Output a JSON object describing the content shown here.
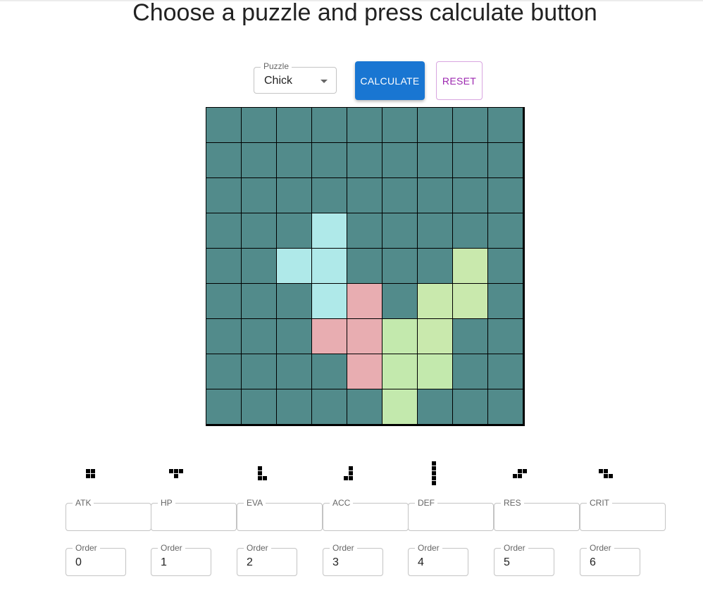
{
  "title": "Choose a puzzle and press calculate button",
  "controls": {
    "puzzle_label": "Puzzle",
    "puzzle_value": "Chick",
    "calculate_label": "CALCULATE",
    "reset_label": "RESET"
  },
  "board": {
    "rows": 9,
    "cols": 9,
    "background_color": "#528b8b",
    "cells": [
      {
        "r": 3,
        "c": 3,
        "color": "#afe9e9"
      },
      {
        "r": 4,
        "c": 2,
        "color": "#afe9e9"
      },
      {
        "r": 4,
        "c": 3,
        "color": "#afe9e9"
      },
      {
        "r": 5,
        "c": 3,
        "color": "#afe9e9"
      },
      {
        "r": 5,
        "c": 4,
        "color": "#e8adb1"
      },
      {
        "r": 6,
        "c": 3,
        "color": "#e8adb1"
      },
      {
        "r": 6,
        "c": 4,
        "color": "#e8adb1"
      },
      {
        "r": 7,
        "c": 4,
        "color": "#e8adb1"
      },
      {
        "r": 4,
        "c": 7,
        "color": "#c9e9ad"
      },
      {
        "r": 5,
        "c": 6,
        "color": "#c9e9ad"
      },
      {
        "r": 5,
        "c": 7,
        "color": "#c9e9ad"
      },
      {
        "r": 6,
        "c": 6,
        "color": "#c9e9ad"
      },
      {
        "r": 6,
        "c": 5,
        "color": "#c3e9ad"
      },
      {
        "r": 7,
        "c": 5,
        "color": "#c3e9ad"
      },
      {
        "r": 7,
        "c": 6,
        "color": "#c3e9ad"
      },
      {
        "r": 8,
        "c": 5,
        "color": "#c3e9ad"
      }
    ]
  },
  "pieces": [
    {
      "icon": "square-piece-icon",
      "cells": [
        [
          0,
          0
        ],
        [
          0,
          1
        ],
        [
          1,
          0
        ],
        [
          1,
          1
        ]
      ]
    },
    {
      "icon": "t-piece-icon",
      "cells": [
        [
          0,
          0
        ],
        [
          0,
          1
        ],
        [
          0,
          2
        ],
        [
          1,
          1
        ]
      ]
    },
    {
      "icon": "l-piece-icon",
      "cells": [
        [
          0,
          0
        ],
        [
          1,
          0
        ],
        [
          2,
          0
        ],
        [
          2,
          1
        ]
      ]
    },
    {
      "icon": "j-piece-icon",
      "cells": [
        [
          0,
          1
        ],
        [
          1,
          1
        ],
        [
          2,
          0
        ],
        [
          2,
          1
        ]
      ]
    },
    {
      "icon": "i-piece-icon",
      "cells": [
        [
          0,
          0
        ],
        [
          1,
          0
        ],
        [
          2,
          0
        ],
        [
          3,
          0
        ],
        [
          4,
          0
        ]
      ]
    },
    {
      "icon": "s-piece-icon",
      "cells": [
        [
          0,
          1
        ],
        [
          0,
          2
        ],
        [
          1,
          0
        ],
        [
          1,
          1
        ]
      ]
    },
    {
      "icon": "z-piece-icon",
      "cells": [
        [
          0,
          0
        ],
        [
          0,
          1
        ],
        [
          1,
          1
        ],
        [
          1,
          2
        ]
      ]
    }
  ],
  "stats": [
    {
      "label": "ATK",
      "value": "",
      "order_label": "Order",
      "order": "0"
    },
    {
      "label": "HP",
      "value": "",
      "order_label": "Order",
      "order": "1"
    },
    {
      "label": "EVA",
      "value": "",
      "order_label": "Order",
      "order": "2"
    },
    {
      "label": "ACC",
      "value": "",
      "order_label": "Order",
      "order": "3"
    },
    {
      "label": "DEF",
      "value": "",
      "order_label": "Order",
      "order": "4"
    },
    {
      "label": "RES",
      "value": "",
      "order_label": "Order",
      "order": "5"
    },
    {
      "label": "CRIT",
      "value": "",
      "order_label": "Order",
      "order": "6"
    }
  ]
}
